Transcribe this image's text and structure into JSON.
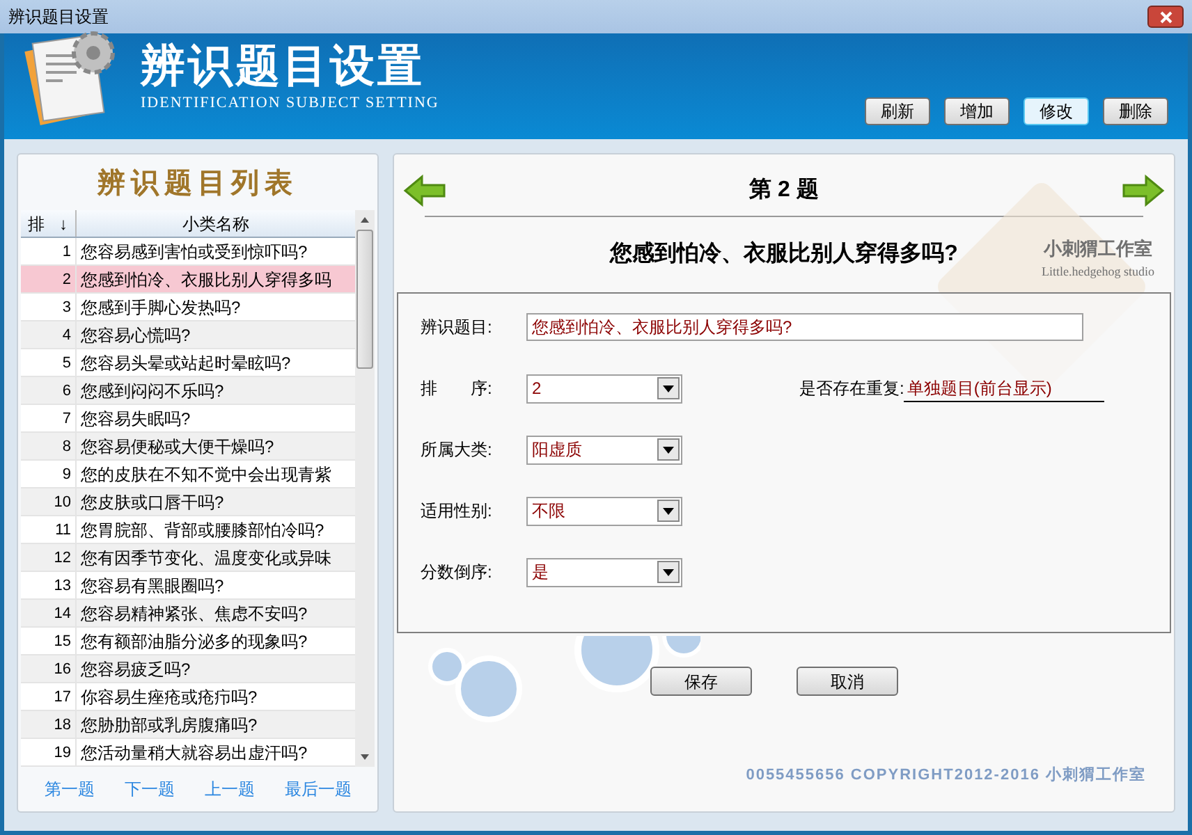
{
  "window": {
    "title": "辨识题目设置"
  },
  "header": {
    "title": "辨识题目设置",
    "subtitle": "IDENTIFICATION SUBJECT SETTING",
    "buttons": [
      {
        "label": "刷新",
        "selected": false
      },
      {
        "label": "增加",
        "selected": false
      },
      {
        "label": "修改",
        "selected": true
      },
      {
        "label": "删除",
        "selected": false
      }
    ]
  },
  "list_panel": {
    "title": "辨识题目列表",
    "columns": [
      "排",
      "↓",
      "小类名称"
    ],
    "rows": [
      {
        "no": "1",
        "name": "您容易感到害怕或受到惊吓吗?",
        "selected": false
      },
      {
        "no": "2",
        "name": "您感到怕冷、衣服比别人穿得多吗",
        "selected": true
      },
      {
        "no": "3",
        "name": "您感到手脚心发热吗?",
        "selected": false
      },
      {
        "no": "4",
        "name": "您容易心慌吗?",
        "selected": false
      },
      {
        "no": "5",
        "name": "您容易头晕或站起时晕眩吗?",
        "selected": false
      },
      {
        "no": "6",
        "name": "您感到闷闷不乐吗?",
        "selected": false
      },
      {
        "no": "7",
        "name": "您容易失眠吗?",
        "selected": false
      },
      {
        "no": "8",
        "name": "您容易便秘或大便干燥吗?",
        "selected": false
      },
      {
        "no": "9",
        "name": "您的皮肤在不知不觉中会出现青紫",
        "selected": false
      },
      {
        "no": "10",
        "name": "您皮肤或口唇干吗?",
        "selected": false
      },
      {
        "no": "11",
        "name": "您胃脘部、背部或腰膝部怕冷吗?",
        "selected": false
      },
      {
        "no": "12",
        "name": "您有因季节变化、温度变化或异味",
        "selected": false
      },
      {
        "no": "13",
        "name": "您容易有黑眼圈吗?",
        "selected": false
      },
      {
        "no": "14",
        "name": "您容易精神紧张、焦虑不安吗?",
        "selected": false
      },
      {
        "no": "15",
        "name": "您有额部油脂分泌多的现象吗?",
        "selected": false
      },
      {
        "no": "16",
        "name": "您容易疲乏吗?",
        "selected": false
      },
      {
        "no": "17",
        "name": "你容易生痤疮或疮疖吗?",
        "selected": false
      },
      {
        "no": "18",
        "name": "您胁肋部或乳房腹痛吗?",
        "selected": false
      },
      {
        "no": "19",
        "name": "您活动量稍大就容易出虚汗吗?",
        "selected": false
      }
    ],
    "nav_links": [
      "第一题",
      "下一题",
      "上一题",
      "最后一题"
    ]
  },
  "detail": {
    "number_title": "第 2 题",
    "question": "您感到怕冷、衣服比别人穿得多吗?",
    "logo_text": "小刺猬工作室",
    "logo_subtext": "Little.hedgehog studio",
    "fields": [
      {
        "kind": "text",
        "label": "辨识题目:",
        "value": "您感到怕冷、衣服比别人穿得多吗?"
      },
      {
        "kind": "select",
        "label": "排　　序:",
        "value": "2"
      },
      {
        "kind": "select",
        "label": "所属大类:",
        "value": "阳虚质"
      },
      {
        "kind": "select",
        "label": "适用性别:",
        "value": "不限"
      },
      {
        "kind": "select",
        "label": "分数倒序:",
        "value": "是"
      }
    ],
    "duplicate": {
      "label": "是否存在重复:",
      "value": "单独题目(前台显示)"
    },
    "buttons": [
      "保存",
      "取消"
    ],
    "copyright": "0055455656 COPYRIGHT2012-2016 小刺猬工作室"
  }
}
